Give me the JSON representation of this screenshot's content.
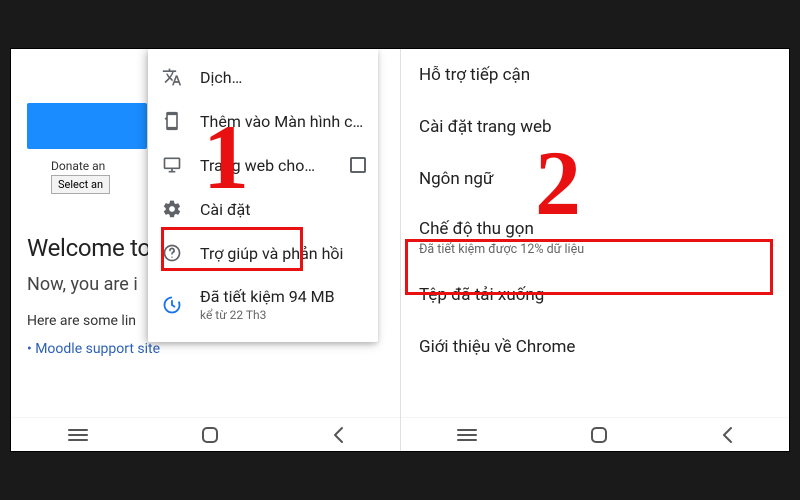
{
  "annotations": {
    "step1": "1",
    "step2": "2"
  },
  "left": {
    "page": {
      "donate_label": "Donate an",
      "select_label": "Select an",
      "welcome": "Welcome to",
      "now": "Now, you are i",
      "here": "Here are some lin",
      "link1": "Moodle support site"
    },
    "menu": {
      "translate": "Dịch…",
      "add_home": "Thêm vào Màn hình c…",
      "desktop_site": "Trang web cho…",
      "settings": "Cài đặt",
      "help": "Trợ giúp và phản hồi",
      "data_saved_main": "Đã tiết kiệm 94 MB",
      "data_saved_sub": "kể từ 22 Th3"
    }
  },
  "right": {
    "items": {
      "accessibility": "Hỗ trợ tiếp cận",
      "site_settings": "Cài đặt trang web",
      "language": "Ngôn ngữ",
      "lite_mode_title": "Chế độ thu gọn",
      "lite_mode_sub": "Đã tiết kiệm được 12% dữ liệu",
      "downloads": "Tệp đã tải xuống",
      "about": "Giới thiệu về Chrome"
    }
  }
}
